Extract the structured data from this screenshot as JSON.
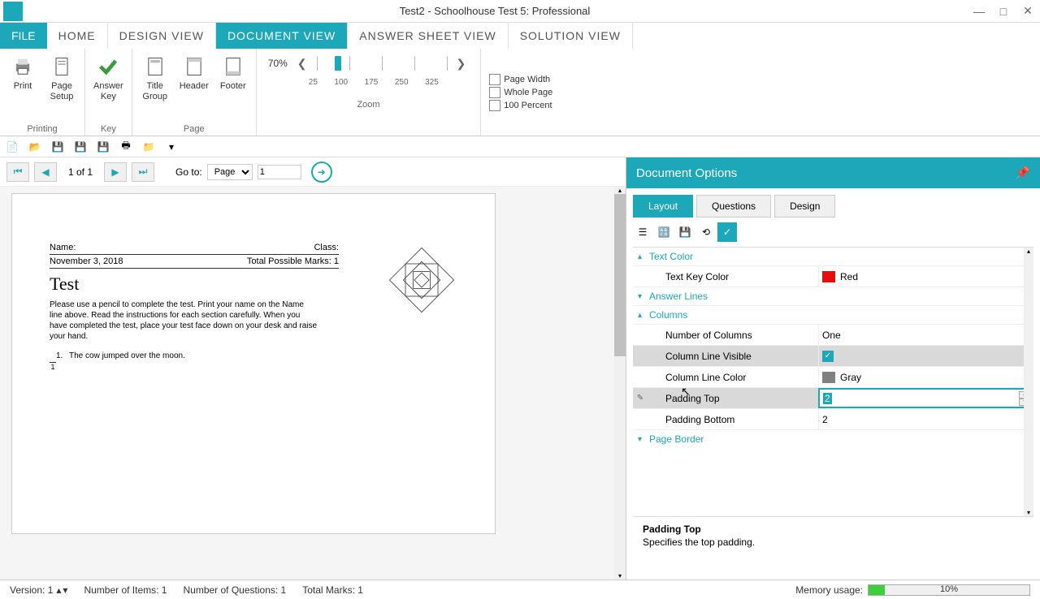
{
  "window": {
    "title": "Test2 - Schoolhouse Test 5: Professional"
  },
  "tabs": {
    "file": "FILE",
    "home": "HOME",
    "design": "DESIGN VIEW",
    "document": "DOCUMENT VIEW",
    "answer_sheet": "ANSWER SHEET VIEW",
    "solution": "SOLUTION VIEW"
  },
  "ribbon": {
    "print": "Print",
    "page_setup": "Page\nSetup",
    "answer_key": "Answer\nKey",
    "title_group": "Title\nGroup",
    "header": "Header",
    "footer": "Footer",
    "printing_group": "Printing",
    "key_group": "Key",
    "page_group": "Page",
    "zoom_group": "Zoom",
    "zoom_pct": "70%",
    "zoom_ticks": [
      "25",
      "100",
      "175",
      "250",
      "325"
    ],
    "page_width": "Page Width",
    "whole_page": "Whole Page",
    "hundred_pct": "100 Percent"
  },
  "nav": {
    "page_of": "1 of 1",
    "goto": "Go to:",
    "goto_type": "Page",
    "goto_num": "1"
  },
  "doc": {
    "name_label": "Name:",
    "class_label": "Class:",
    "date": "November 3, 2018",
    "marks": "Total Possible Marks: 1",
    "title": "Test",
    "intro": "Please use a pencil to complete the test. Print your name on the Name line above. Read the instructions for each section carefully. When you have completed the test, place your test face down on your desk and raise your hand.",
    "q1": "The cow jumped over the moon.",
    "q1_num": "1.",
    "q1_mark": "1"
  },
  "options": {
    "title": "Document Options",
    "tabs": {
      "layout": "Layout",
      "questions": "Questions",
      "design": "Design"
    },
    "sections": {
      "text_color": "Text Color",
      "answer_lines": "Answer Lines",
      "columns": "Columns",
      "page_border": "Page Border"
    },
    "props": {
      "text_key_color": {
        "label": "Text Key Color",
        "value": "Red",
        "color": "#e01010"
      },
      "num_columns": {
        "label": "Number of Columns",
        "value": "One"
      },
      "col_line_visible": {
        "label": "Column Line Visible"
      },
      "col_line_color": {
        "label": "Column Line Color",
        "value": "Gray",
        "color": "#808080"
      },
      "padding_top": {
        "label": "Padding Top",
        "value": "2"
      },
      "padding_bottom": {
        "label": "Padding Bottom",
        "value": "2"
      }
    },
    "desc": {
      "title": "Padding Top",
      "text": "Specifies the top padding."
    }
  },
  "status": {
    "version": "Version: 1",
    "items": "Number of Items: 1",
    "questions": "Number of Questions: 1",
    "marks": "Total Marks: 1",
    "mem_label": "Memory usage:",
    "mem_pct": "10%"
  }
}
